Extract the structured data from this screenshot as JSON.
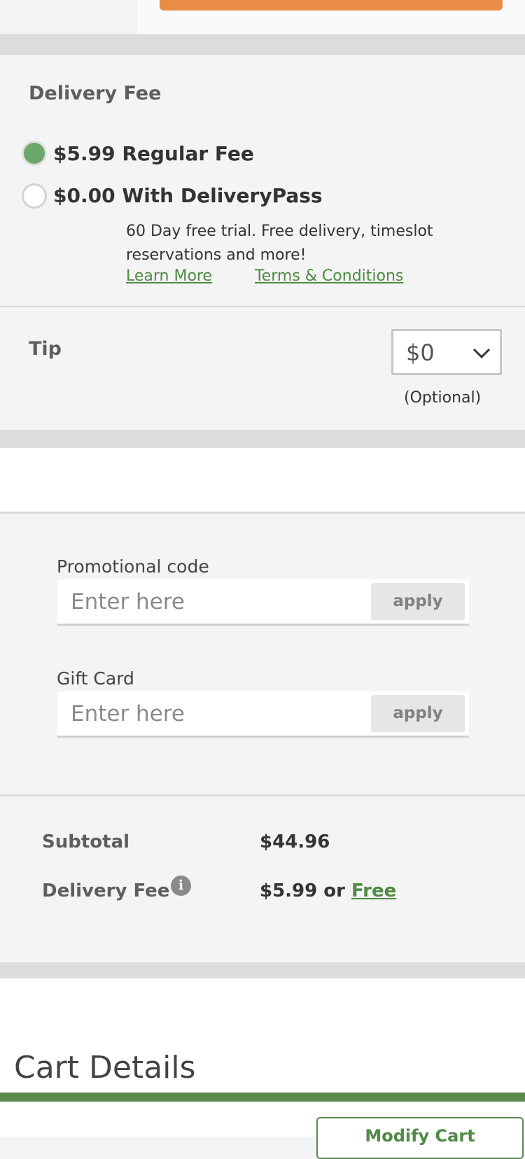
{
  "delivery": {
    "title": "Delivery Fee",
    "options": [
      {
        "label": "$5.99 Regular Fee",
        "selected": true
      },
      {
        "label": "$0.00 With DeliveryPass",
        "selected": false
      }
    ],
    "pass_description": "60 Day free trial. Free delivery, timeslot reservations and more!",
    "learn_more": "Learn More",
    "terms": "Terms & Conditions"
  },
  "tip": {
    "title": "Tip",
    "value": "$0",
    "note": "(Optional)"
  },
  "promo": {
    "label": "Promotional code",
    "placeholder": "Enter here",
    "apply": "apply"
  },
  "gift_card": {
    "label": "Gift Card",
    "placeholder": "Enter here",
    "apply": "apply"
  },
  "summary": {
    "subtotal_label": "Subtotal",
    "subtotal_value": "$44.96",
    "delivery_label": "Delivery Fee",
    "delivery_value": "$5.99 or",
    "delivery_free": "Free"
  },
  "cart": {
    "title": "Cart Details",
    "modify": "Modify Cart"
  },
  "colors": {
    "accent_orange": "#e98c45",
    "accent_green": "#5b8a4f",
    "selected_radio": "#6ea76b"
  }
}
